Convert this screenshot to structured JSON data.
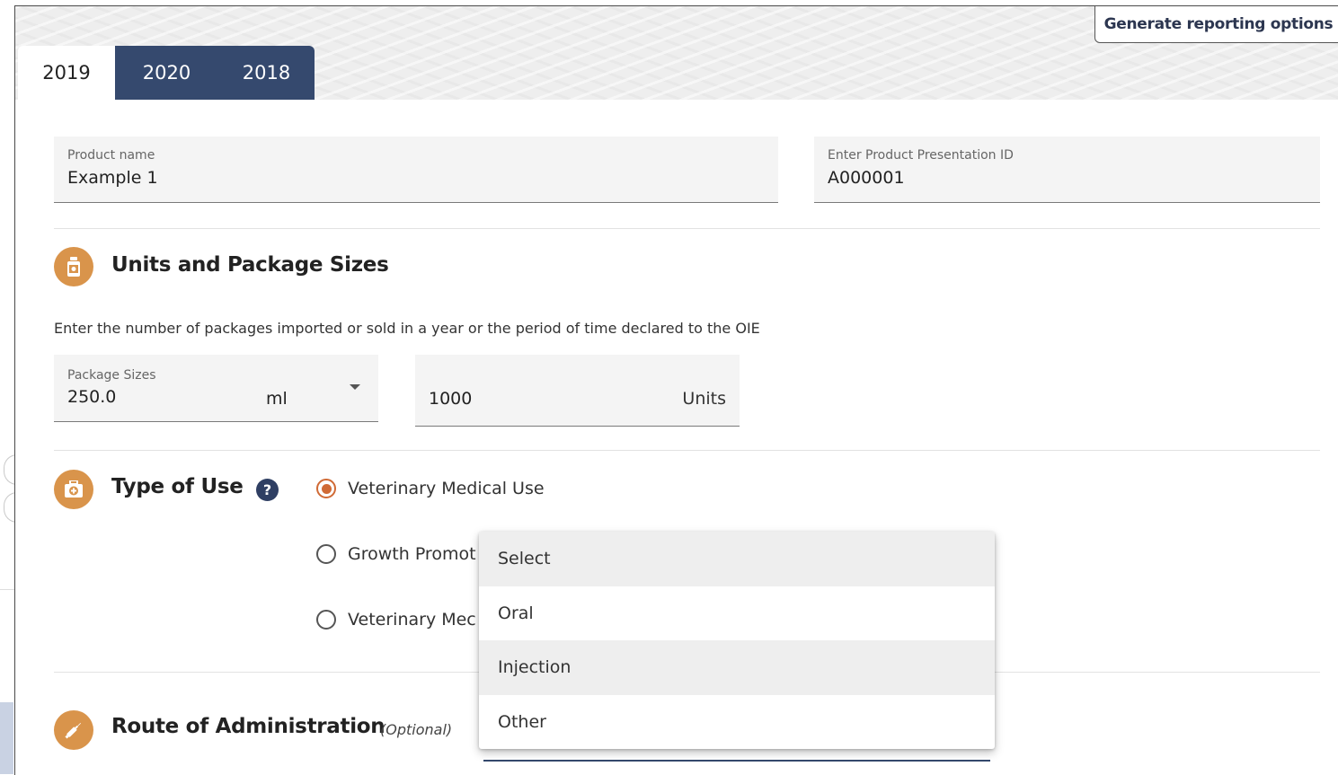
{
  "header": {
    "generate_button": "Generate reporting options",
    "tabs": [
      {
        "label": "2019",
        "active": true
      },
      {
        "label": "2020",
        "active": false
      },
      {
        "label": "2018",
        "active": false
      }
    ]
  },
  "product": {
    "name_label": "Product name",
    "name_value": "Example 1",
    "presentation_label": "Enter Product Presentation ID",
    "presentation_value": "A000001"
  },
  "units_section": {
    "title": "Units and Package Sizes",
    "description": "Enter the number of packages imported or sold in a year or the period of time declared to the OIE",
    "package_label": "Package Sizes",
    "package_value": "250.0",
    "package_unit": "ml",
    "units_value": "1000",
    "units_suffix": "Units"
  },
  "type_of_use": {
    "title": "Type of Use",
    "help": "?",
    "options": [
      {
        "label": "Veterinary Medical Use",
        "checked": true
      },
      {
        "label": "Growth Promot",
        "checked": false
      },
      {
        "label": "Veterinary Mec",
        "checked": false
      }
    ]
  },
  "route_section": {
    "title": "Route of Administration",
    "optional": "(Optional)"
  },
  "dropdown": {
    "items": [
      "Select",
      "Oral",
      "Injection",
      "Other"
    ]
  },
  "colors": {
    "accent_orange": "#d9944b",
    "tab_navy": "#35496e",
    "radio_checked": "#d06a35"
  }
}
